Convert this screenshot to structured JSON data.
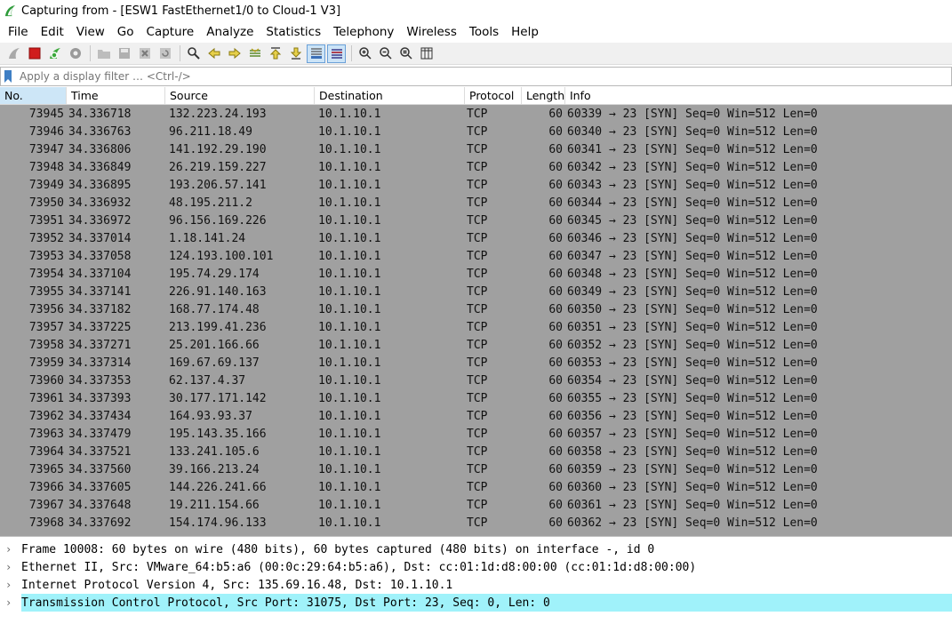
{
  "window": {
    "title": "Capturing from - [ESW1 FastEthernet1/0 to Cloud-1 V3]"
  },
  "menu": [
    "File",
    "Edit",
    "View",
    "Go",
    "Capture",
    "Analyze",
    "Statistics",
    "Telephony",
    "Wireless",
    "Tools",
    "Help"
  ],
  "toolbar": {
    "icons": [
      "shark-fin-start-icon",
      "stop-capture-icon",
      "restart-capture-icon",
      "capture-options-icon",
      "open-file-icon",
      "save-file-icon",
      "close-file-icon",
      "reload-file-icon",
      "find-packet-icon",
      "go-back-icon",
      "go-forward-icon",
      "go-to-packet-icon",
      "go-first-packet-icon",
      "go-last-packet-icon",
      "auto-scroll-icon",
      "colorize-icon",
      "zoom-in-icon",
      "zoom-out-icon",
      "normal-size-icon",
      "resize-columns-icon"
    ]
  },
  "filter": {
    "placeholder": "Apply a display filter … <Ctrl-/>"
  },
  "columns": {
    "no": "No.",
    "time": "Time",
    "source": "Source",
    "destination": "Destination",
    "protocol": "Protocol",
    "length": "Length",
    "info": "Info"
  },
  "packets": [
    {
      "no": "73945",
      "time": "34.336718",
      "src": "132.223.24.193",
      "dst": "10.1.10.1",
      "proto": "TCP",
      "len": "60",
      "info": "60339 → 23 [SYN] Seq=0 Win=512 Len=0"
    },
    {
      "no": "73946",
      "time": "34.336763",
      "src": "96.211.18.49",
      "dst": "10.1.10.1",
      "proto": "TCP",
      "len": "60",
      "info": "60340 → 23 [SYN] Seq=0 Win=512 Len=0"
    },
    {
      "no": "73947",
      "time": "34.336806",
      "src": "141.192.29.190",
      "dst": "10.1.10.1",
      "proto": "TCP",
      "len": "60",
      "info": "60341 → 23 [SYN] Seq=0 Win=512 Len=0"
    },
    {
      "no": "73948",
      "time": "34.336849",
      "src": "26.219.159.227",
      "dst": "10.1.10.1",
      "proto": "TCP",
      "len": "60",
      "info": "60342 → 23 [SYN] Seq=0 Win=512 Len=0"
    },
    {
      "no": "73949",
      "time": "34.336895",
      "src": "193.206.57.141",
      "dst": "10.1.10.1",
      "proto": "TCP",
      "len": "60",
      "info": "60343 → 23 [SYN] Seq=0 Win=512 Len=0"
    },
    {
      "no": "73950",
      "time": "34.336932",
      "src": "48.195.211.2",
      "dst": "10.1.10.1",
      "proto": "TCP",
      "len": "60",
      "info": "60344 → 23 [SYN] Seq=0 Win=512 Len=0"
    },
    {
      "no": "73951",
      "time": "34.336972",
      "src": "96.156.169.226",
      "dst": "10.1.10.1",
      "proto": "TCP",
      "len": "60",
      "info": "60345 → 23 [SYN] Seq=0 Win=512 Len=0"
    },
    {
      "no": "73952",
      "time": "34.337014",
      "src": "1.18.141.24",
      "dst": "10.1.10.1",
      "proto": "TCP",
      "len": "60",
      "info": "60346 → 23 [SYN] Seq=0 Win=512 Len=0"
    },
    {
      "no": "73953",
      "time": "34.337058",
      "src": "124.193.100.101",
      "dst": "10.1.10.1",
      "proto": "TCP",
      "len": "60",
      "info": "60347 → 23 [SYN] Seq=0 Win=512 Len=0"
    },
    {
      "no": "73954",
      "time": "34.337104",
      "src": "195.74.29.174",
      "dst": "10.1.10.1",
      "proto": "TCP",
      "len": "60",
      "info": "60348 → 23 [SYN] Seq=0 Win=512 Len=0"
    },
    {
      "no": "73955",
      "time": "34.337141",
      "src": "226.91.140.163",
      "dst": "10.1.10.1",
      "proto": "TCP",
      "len": "60",
      "info": "60349 → 23 [SYN] Seq=0 Win=512 Len=0"
    },
    {
      "no": "73956",
      "time": "34.337182",
      "src": "168.77.174.48",
      "dst": "10.1.10.1",
      "proto": "TCP",
      "len": "60",
      "info": "60350 → 23 [SYN] Seq=0 Win=512 Len=0"
    },
    {
      "no": "73957",
      "time": "34.337225",
      "src": "213.199.41.236",
      "dst": "10.1.10.1",
      "proto": "TCP",
      "len": "60",
      "info": "60351 → 23 [SYN] Seq=0 Win=512 Len=0"
    },
    {
      "no": "73958",
      "time": "34.337271",
      "src": "25.201.166.66",
      "dst": "10.1.10.1",
      "proto": "TCP",
      "len": "60",
      "info": "60352 → 23 [SYN] Seq=0 Win=512 Len=0"
    },
    {
      "no": "73959",
      "time": "34.337314",
      "src": "169.67.69.137",
      "dst": "10.1.10.1",
      "proto": "TCP",
      "len": "60",
      "info": "60353 → 23 [SYN] Seq=0 Win=512 Len=0"
    },
    {
      "no": "73960",
      "time": "34.337353",
      "src": "62.137.4.37",
      "dst": "10.1.10.1",
      "proto": "TCP",
      "len": "60",
      "info": "60354 → 23 [SYN] Seq=0 Win=512 Len=0"
    },
    {
      "no": "73961",
      "time": "34.337393",
      "src": "30.177.171.142",
      "dst": "10.1.10.1",
      "proto": "TCP",
      "len": "60",
      "info": "60355 → 23 [SYN] Seq=0 Win=512 Len=0"
    },
    {
      "no": "73962",
      "time": "34.337434",
      "src": "164.93.93.37",
      "dst": "10.1.10.1",
      "proto": "TCP",
      "len": "60",
      "info": "60356 → 23 [SYN] Seq=0 Win=512 Len=0"
    },
    {
      "no": "73963",
      "time": "34.337479",
      "src": "195.143.35.166",
      "dst": "10.1.10.1",
      "proto": "TCP",
      "len": "60",
      "info": "60357 → 23 [SYN] Seq=0 Win=512 Len=0"
    },
    {
      "no": "73964",
      "time": "34.337521",
      "src": "133.241.105.6",
      "dst": "10.1.10.1",
      "proto": "TCP",
      "len": "60",
      "info": "60358 → 23 [SYN] Seq=0 Win=512 Len=0"
    },
    {
      "no": "73965",
      "time": "34.337560",
      "src": "39.166.213.24",
      "dst": "10.1.10.1",
      "proto": "TCP",
      "len": "60",
      "info": "60359 → 23 [SYN] Seq=0 Win=512 Len=0"
    },
    {
      "no": "73966",
      "time": "34.337605",
      "src": "144.226.241.66",
      "dst": "10.1.10.1",
      "proto": "TCP",
      "len": "60",
      "info": "60360 → 23 [SYN] Seq=0 Win=512 Len=0"
    },
    {
      "no": "73967",
      "time": "34.337648",
      "src": "19.211.154.66",
      "dst": "10.1.10.1",
      "proto": "TCP",
      "len": "60",
      "info": "60361 → 23 [SYN] Seq=0 Win=512 Len=0"
    },
    {
      "no": "73968",
      "time": "34.337692",
      "src": "154.174.96.133",
      "dst": "10.1.10.1",
      "proto": "TCP",
      "len": "60",
      "info": "60362 → 23 [SYN] Seq=0 Win=512 Len=0"
    }
  ],
  "details": [
    {
      "text": "Frame 10008: 60 bytes on wire (480 bits), 60 bytes captured (480 bits) on interface -, id 0",
      "selected": false
    },
    {
      "text": "Ethernet II, Src: VMware_64:b5:a6 (00:0c:29:64:b5:a6), Dst: cc:01:1d:d8:00:00 (cc:01:1d:d8:00:00)",
      "selected": false
    },
    {
      "text": "Internet Protocol Version 4, Src: 135.69.16.48, Dst: 10.1.10.1",
      "selected": false
    },
    {
      "text": "Transmission Control Protocol, Src Port: 31075, Dst Port: 23, Seq: 0, Len: 0",
      "selected": true
    }
  ],
  "colors": {
    "row_background": "#a0a0a0",
    "selected_detail": "#a0f2fa",
    "sorted_column": "#cde6f7"
  }
}
